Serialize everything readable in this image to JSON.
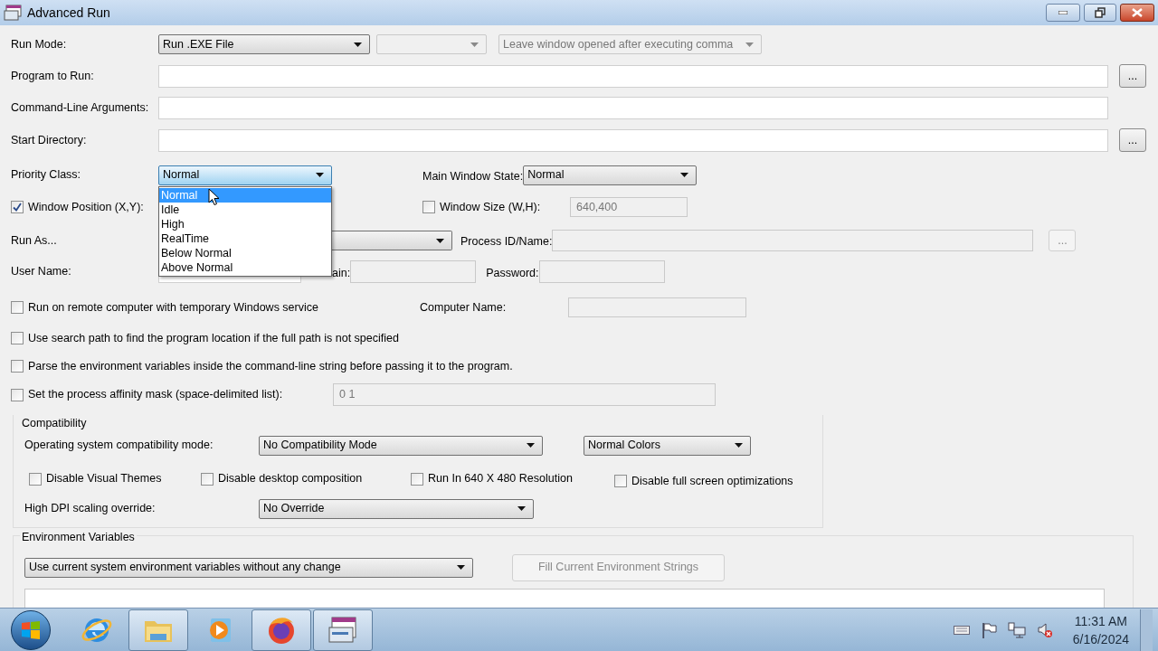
{
  "window": {
    "title": "Advanced Run"
  },
  "run_mode": {
    "label": "Run Mode:",
    "value": "Run .EXE File",
    "option_value_disabled": true,
    "window_option": {
      "value": "Leave window opened after executing comma",
      "disabled": true
    }
  },
  "paths": [
    {
      "label": "Program to Run:",
      "browse_button": "..."
    },
    {
      "label": "Command-Line Arguments:"
    },
    {
      "label": "Start Directory:",
      "browse_button": "..."
    }
  ],
  "priority": {
    "label": "Priority Class:",
    "value": "Normal",
    "expanded": true,
    "options": [
      {
        "label": "Normal",
        "selected": true
      },
      {
        "label": "Idle",
        "selected": false
      },
      {
        "label": "High",
        "selected": false
      },
      {
        "label": "RealTime",
        "selected": false
      },
      {
        "label": "Below Normal",
        "selected": false
      },
      {
        "label": "Above Normal",
        "selected": false
      }
    ]
  },
  "main_window_state": {
    "label": "Main Window State:",
    "value": "Normal"
  },
  "window_position": {
    "label": "Window Position (X,Y):",
    "checked": true
  },
  "window_size": {
    "label": "Window Size (W,H):",
    "checked": false,
    "value": "640,400",
    "disabled": true
  },
  "run_as": {
    "label": "Run As..."
  },
  "process": {
    "label": "Process ID/Name:",
    "button": "...",
    "disabled": true
  },
  "user_name": {
    "label": "User Name:"
  },
  "domain": {
    "label": "ain:",
    "disabled": true
  },
  "password": {
    "label": "Password:",
    "disabled": true
  },
  "remote": {
    "label": "Run on remote computer with temporary Windows service",
    "checked": false
  },
  "computer_name": {
    "label": "Computer Name:",
    "disabled": true
  },
  "search_path": {
    "label": "Use search path to find the program location if the full path is not specified",
    "checked": false
  },
  "parse_env": {
    "label": "Parse the environment variables inside the command-line string before passing it to the program.",
    "checked": false
  },
  "affinity": {
    "label": "Set the process affinity mask (space-delimited list):",
    "checked": false,
    "value": "0 1",
    "disabled": true
  },
  "compatibility": {
    "title": "Compatibility",
    "os_mode": {
      "label": "Operating system compatibility mode:",
      "value": "No Compatibility Mode"
    },
    "colors": {
      "value": "Normal Colors"
    },
    "checkboxes": [
      {
        "label": "Disable Visual Themes",
        "checked": false
      },
      {
        "label": "Disable desktop composition",
        "checked": false
      },
      {
        "label": "Run In 640 X 480 Resolution",
        "checked": false
      },
      {
        "label": "Disable full screen optimizations",
        "checked": false
      }
    ],
    "dpi": {
      "label": "High DPI scaling override:",
      "value": "No Override"
    }
  },
  "environment": {
    "title": "Environment Variables",
    "mode": {
      "value": "Use current system environment variables without any change"
    },
    "fill_button": {
      "label": "Fill Current Environment Strings",
      "disabled": true
    }
  },
  "taskbar": {
    "apps": [
      {
        "kind": "ie",
        "running": false
      },
      {
        "kind": "explorer",
        "running": true
      },
      {
        "kind": "media",
        "running": false
      },
      {
        "kind": "firefox",
        "running": true
      },
      {
        "kind": "advancedrun",
        "running": true
      }
    ],
    "time": "11:31 AM",
    "date": "6/16/2024"
  }
}
